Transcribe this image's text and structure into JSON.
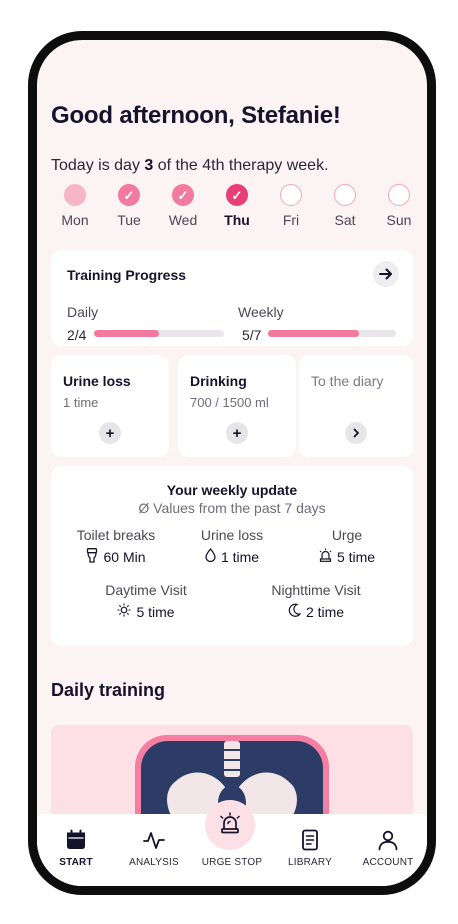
{
  "greeting": "Good afternoon, Stefanie!",
  "therapy": {
    "prefix": "Today is day ",
    "day": "3",
    "suffix": " of the 4th therapy week."
  },
  "week": [
    {
      "label": "Mon",
      "state": "soft"
    },
    {
      "label": "Tue",
      "state": "done"
    },
    {
      "label": "Wed",
      "state": "done"
    },
    {
      "label": "Thu",
      "state": "current"
    },
    {
      "label": "Fri",
      "state": "empty"
    },
    {
      "label": "Sat",
      "state": "empty"
    },
    {
      "label": "Sun",
      "state": "empty"
    }
  ],
  "training_progress": {
    "title": "Training Progress",
    "daily_label": "Daily",
    "daily_count": "2/4",
    "daily_fraction": 0.5,
    "weekly_label": "Weekly",
    "weekly_count": "5/7",
    "weekly_fraction": 0.71
  },
  "cards": {
    "urine_title": "Urine loss",
    "urine_value": "1 time",
    "drinking_title": "Drinking",
    "drinking_value": "700 / 1500 ml",
    "diary_label": "To the diary",
    "add_glyph": "+"
  },
  "weekly_update": {
    "title": "Your weekly update",
    "subtitle": "Ø Values from the past 7 days",
    "toilet_label": "Toilet breaks",
    "toilet_value": "60 Min",
    "urine_label": "Urine loss",
    "urine_value": "1 time",
    "urge_label": "Urge",
    "urge_value": "5 time",
    "daytime_label": "Daytime Visit",
    "daytime_value": "5 time",
    "night_label": "Nighttime Visit",
    "night_value": "2 time"
  },
  "daily_training": {
    "heading": "Daily training"
  },
  "tabbar": {
    "start": "START",
    "analysis": "ANALYSIS",
    "urge_stop": "URGE STOP",
    "library": "LIBRARY",
    "account": "ACCOUNT"
  },
  "colors": {
    "accent": "#f27a9f",
    "current": "#e83e76",
    "background": "#fbf3f4",
    "navy": "#2c3c66"
  }
}
